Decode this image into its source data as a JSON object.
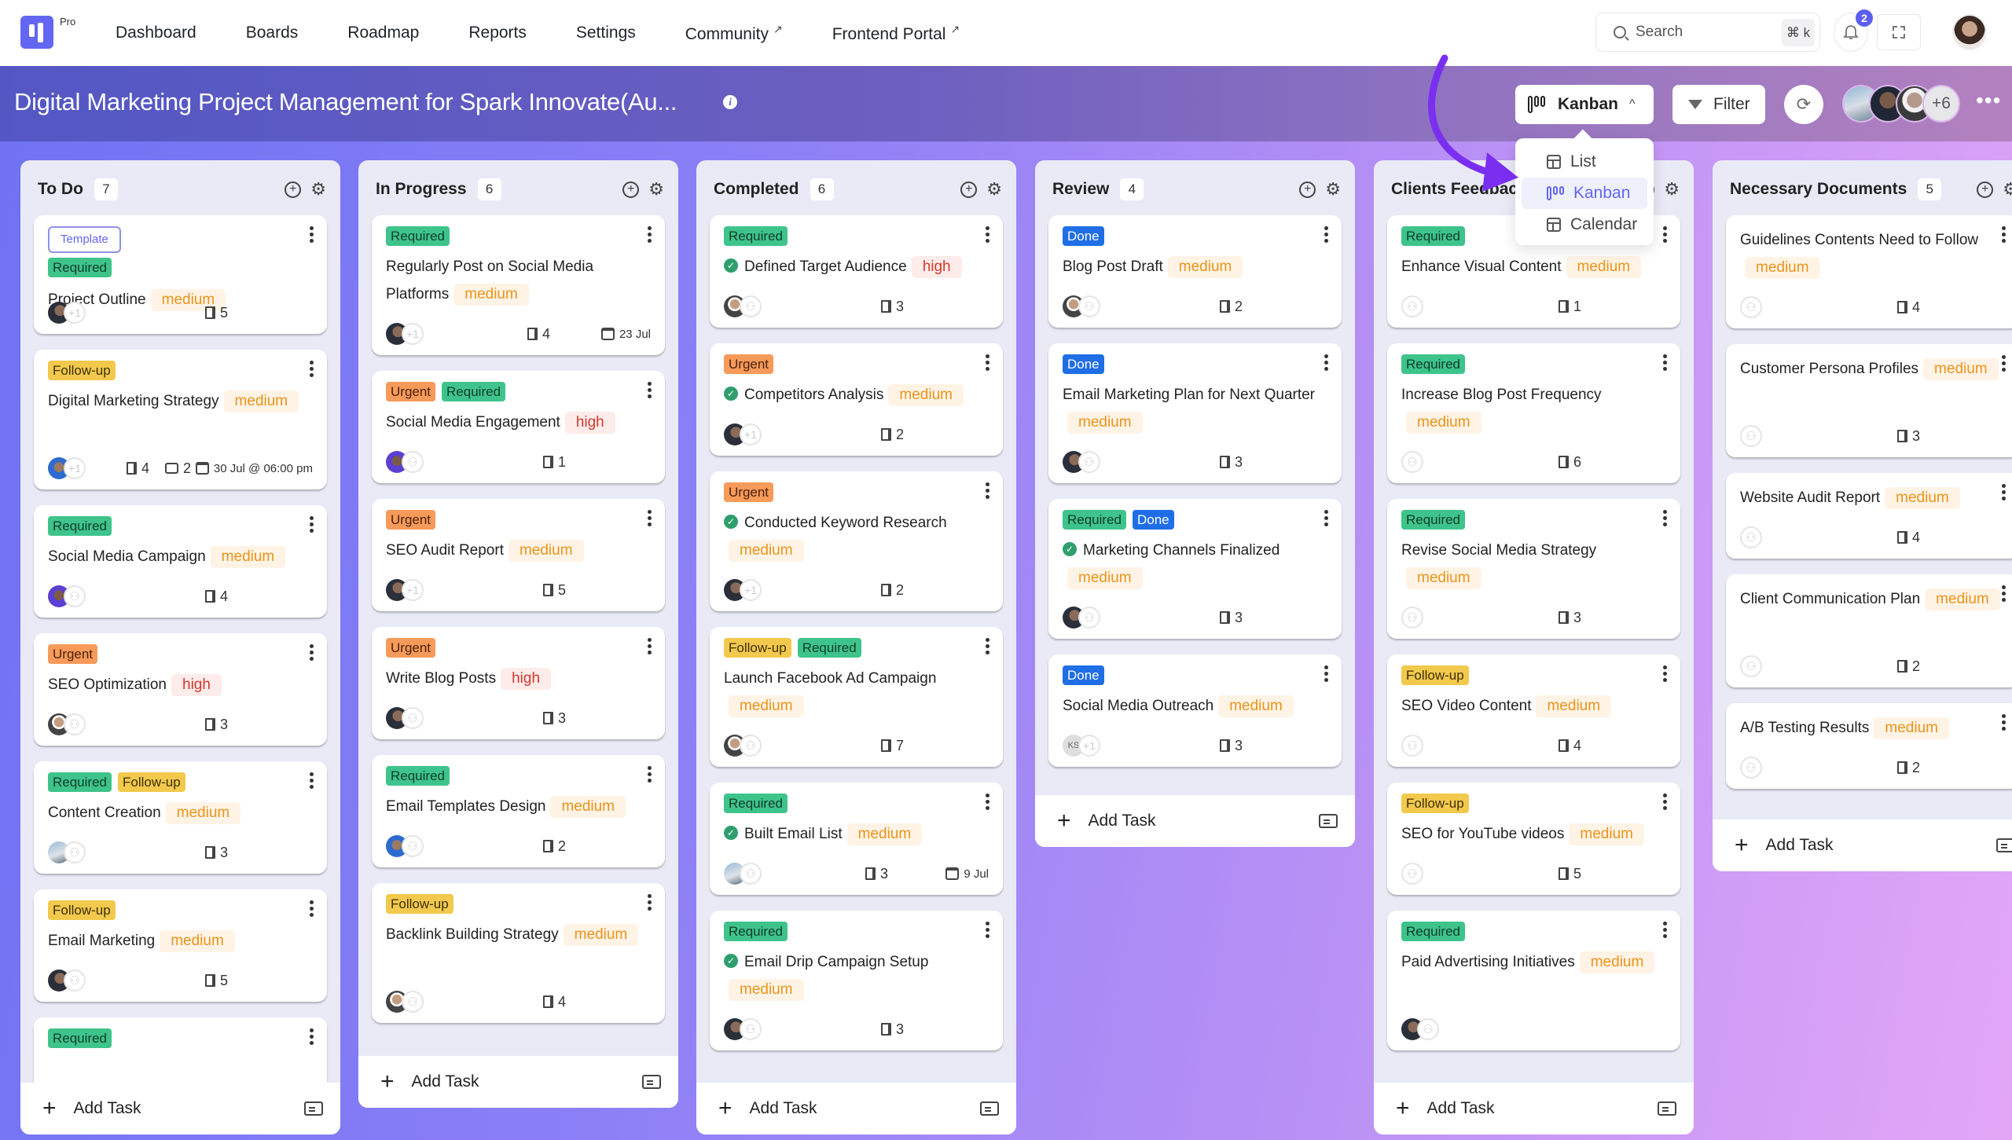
{
  "nav": {
    "logo_badge": "Pro",
    "items": [
      {
        "label": "Dashboard",
        "external": false
      },
      {
        "label": "Boards",
        "external": false
      },
      {
        "label": "Roadmap",
        "external": false
      },
      {
        "label": "Reports",
        "external": false
      },
      {
        "label": "Settings",
        "external": false
      },
      {
        "label": "Community",
        "external": true
      },
      {
        "label": "Frontend Portal",
        "external": true
      }
    ],
    "external_glyph": "↗",
    "search_placeholder": "Search",
    "search_shortcut": "⌘ k",
    "notification_count": "2"
  },
  "header": {
    "title": "Digital Marketing Project Management for Spark Innovate(Au...",
    "info_icon": "i",
    "view_selector": {
      "label": "Kanban",
      "chevron": "^"
    },
    "filter_label": "Filter",
    "refresh_icon": "⟳",
    "members_extra": "+6",
    "more_icon": "•••"
  },
  "view_menu": {
    "items": [
      {
        "label": "List",
        "icon": "table-icon",
        "active": false
      },
      {
        "label": "Kanban",
        "icon": "kanban-icon",
        "active": true
      },
      {
        "label": "Calendar",
        "icon": "table-icon",
        "active": false
      }
    ]
  },
  "colors": {
    "accent": "#6366f1",
    "required": "#3ec48b",
    "urgent": "#f79a5a",
    "followup": "#f2c94c",
    "done": "#1f6ee6",
    "medium": "#ea9418",
    "high": "#d6382c"
  },
  "add_task_label": "Add Task",
  "columns": [
    {
      "title": "To Do",
      "count": "7",
      "cards": [
        {
          "tags": [
            "Template",
            "Required"
          ],
          "title": "Project Outline",
          "priority": "medium",
          "check": false,
          "avatar": "photo",
          "extra": "+1",
          "subtasks": "5"
        },
        {
          "tags": [
            "Follow-up"
          ],
          "title": "Digital Marketing Strategy",
          "priority": "medium",
          "check": false,
          "avatar": "photo5",
          "extra": "+1",
          "subtasks": "4",
          "comments": "2",
          "date": "30 Jul @ 06:00 pm"
        },
        {
          "tags": [
            "Required"
          ],
          "title": "Social Media Campaign",
          "priority": "medium",
          "check": false,
          "avatar": "photo4",
          "extra": "add",
          "subtasks": "4"
        },
        {
          "tags": [
            "Urgent"
          ],
          "title": "SEO Optimization",
          "priority": "high",
          "check": false,
          "avatar": "photo2",
          "extra": "add",
          "subtasks": "3"
        },
        {
          "tags": [
            "Required",
            "Follow-up"
          ],
          "title": "Content Creation",
          "priority": "medium",
          "check": false,
          "avatar": "photo3",
          "extra": "add",
          "subtasks": "3"
        },
        {
          "tags": [
            "Follow-up"
          ],
          "title": "Email Marketing",
          "priority": "medium",
          "check": false,
          "avatar": "photo",
          "extra": "add",
          "subtasks": "5"
        },
        {
          "tags": [
            "Required"
          ],
          "title": "",
          "priority": "",
          "check": false,
          "avatar": "",
          "extra": "",
          "subtasks": ""
        }
      ]
    },
    {
      "title": "In Progress",
      "count": "6",
      "cards": [
        {
          "tags": [
            "Required"
          ],
          "title": "Regularly Post on Social Media Platforms",
          "priority": "medium",
          "check": false,
          "avatar": "photo",
          "extra": "+1",
          "subtasks": "4",
          "date": "23 Jul"
        },
        {
          "tags": [
            "Urgent",
            "Required"
          ],
          "title": "Social Media Engagement",
          "priority": "high",
          "check": false,
          "avatar": "photo4",
          "extra": "add",
          "subtasks": "1"
        },
        {
          "tags": [
            "Urgent"
          ],
          "title": "SEO Audit Report",
          "priority": "medium",
          "check": false,
          "avatar": "photo",
          "extra": "+1",
          "subtasks": "5"
        },
        {
          "tags": [
            "Urgent"
          ],
          "title": "Write Blog Posts",
          "priority": "high",
          "check": false,
          "avatar": "photo",
          "extra": "add",
          "subtasks": "3"
        },
        {
          "tags": [
            "Required"
          ],
          "title": "Email Templates Design",
          "priority": "medium",
          "check": false,
          "avatar": "photo5",
          "extra": "add",
          "subtasks": "2"
        },
        {
          "tags": [
            "Follow-up"
          ],
          "title": "Backlink Building Strategy",
          "priority": "medium",
          "check": false,
          "avatar": "photo2",
          "extra": "add",
          "subtasks": "4"
        }
      ]
    },
    {
      "title": "Completed",
      "count": "6",
      "cards": [
        {
          "tags": [
            "Required"
          ],
          "title": "Defined Target Audience",
          "priority": "high",
          "check": true,
          "avatar": "photo2",
          "extra": "add",
          "subtasks": "3"
        },
        {
          "tags": [
            "Urgent"
          ],
          "title": "Competitors Analysis",
          "priority": "medium",
          "check": true,
          "avatar": "photo",
          "extra": "+1",
          "subtasks": "2"
        },
        {
          "tags": [
            "Urgent"
          ],
          "title": "Conducted Keyword Research",
          "priority": "medium",
          "check": true,
          "avatar": "photo",
          "extra": "+1",
          "subtasks": "2"
        },
        {
          "tags": [
            "Follow-up",
            "Required"
          ],
          "title": "Launch Facebook Ad Campaign",
          "priority": "medium",
          "check": false,
          "avatar": "photo2",
          "extra": "add",
          "subtasks": "7"
        },
        {
          "tags": [
            "Required"
          ],
          "title": "Built Email List",
          "priority": "medium",
          "check": true,
          "avatar": "photo3",
          "extra": "add",
          "subtasks": "3",
          "date": "9 Jul"
        },
        {
          "tags": [
            "Required"
          ],
          "title": "Email Drip Campaign Setup",
          "priority": "medium",
          "check": true,
          "avatar": "photo",
          "extra": "add",
          "subtasks": "3"
        }
      ]
    },
    {
      "title": "Review",
      "count": "4",
      "cards": [
        {
          "tags": [
            "Done"
          ],
          "title": "Blog Post Draft",
          "priority": "medium",
          "check": false,
          "avatar": "photo2",
          "extra": "add",
          "subtasks": "2"
        },
        {
          "tags": [
            "Done"
          ],
          "title": "Email Marketing Plan for Next Quarter",
          "priority": "medium",
          "check": false,
          "avatar": "photo",
          "extra": "add",
          "subtasks": "3"
        },
        {
          "tags": [
            "Required",
            "Done"
          ],
          "title": "Marketing Channels Finalized",
          "priority": "medium",
          "check": true,
          "avatar": "photo",
          "extra": "add",
          "subtasks": "3"
        },
        {
          "tags": [
            "Done"
          ],
          "title": "Social Media Outreach",
          "priority": "medium",
          "check": false,
          "avatar": "ks",
          "avatar_initials": "KS",
          "extra": "+1",
          "subtasks": "3"
        }
      ]
    },
    {
      "title": "Clients Feedback",
      "count": "",
      "cards": [
        {
          "tags": [
            "Required"
          ],
          "title": "Enhance Visual Content",
          "priority": "medium",
          "check": false,
          "avatar": "",
          "extra": "add",
          "subtasks": "1"
        },
        {
          "tags": [
            "Required"
          ],
          "title": "Increase Blog Post Frequency",
          "priority": "medium",
          "check": false,
          "avatar": "",
          "extra": "add",
          "subtasks": "6"
        },
        {
          "tags": [
            "Required"
          ],
          "title": "Revise Social Media Strategy",
          "priority": "medium",
          "check": false,
          "avatar": "",
          "extra": "add",
          "subtasks": "3"
        },
        {
          "tags": [
            "Follow-up"
          ],
          "title": "SEO Video Content",
          "priority": "medium",
          "check": false,
          "avatar": "",
          "extra": "add",
          "subtasks": "4"
        },
        {
          "tags": [
            "Follow-up"
          ],
          "title": "SEO for YouTube videos",
          "priority": "medium",
          "check": false,
          "avatar": "",
          "extra": "add",
          "subtasks": "5"
        },
        {
          "tags": [
            "Required"
          ],
          "title": "Paid Advertising Initiatives",
          "priority": "medium",
          "check": false,
          "avatar": "photo",
          "extra": "add",
          "subtasks": ""
        }
      ]
    },
    {
      "title": "Necessary Documents",
      "count": "5",
      "cards": [
        {
          "tags": [],
          "title": "Guidelines Contents Need to Follow",
          "priority": "medium",
          "check": false,
          "avatar": "",
          "extra": "add",
          "subtasks": "4"
        },
        {
          "tags": [],
          "title": "Customer Persona Profiles",
          "priority": "medium",
          "check": false,
          "avatar": "",
          "extra": "add",
          "subtasks": "3"
        },
        {
          "tags": [],
          "title": "Website Audit Report",
          "priority": "medium",
          "check": false,
          "avatar": "",
          "extra": "add",
          "subtasks": "4"
        },
        {
          "tags": [],
          "title": "Client Communication Plan",
          "priority": "medium",
          "check": false,
          "avatar": "",
          "extra": "add",
          "subtasks": "2"
        },
        {
          "tags": [],
          "title": "A/B Testing Results",
          "priority": "medium",
          "check": false,
          "avatar": "",
          "extra": "add",
          "subtasks": "2"
        }
      ]
    }
  ]
}
